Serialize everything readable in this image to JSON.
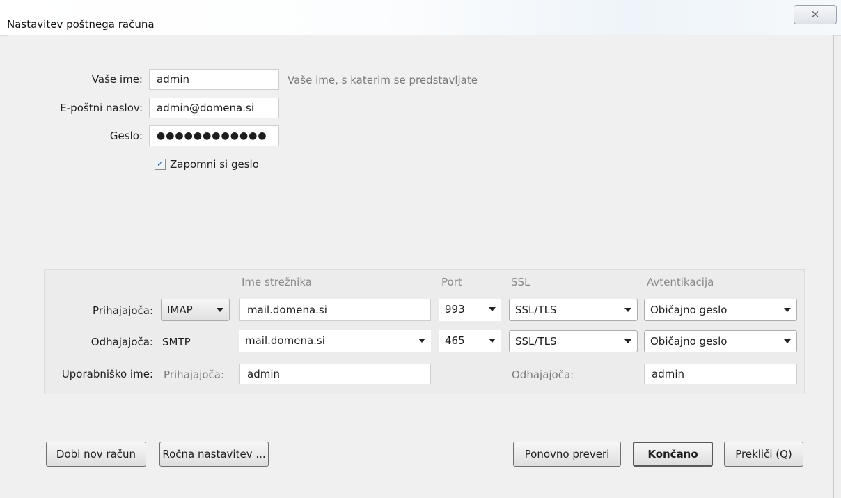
{
  "window": {
    "title": "Nastavitev poštnega računa",
    "close_glyph": "⨯"
  },
  "identity": {
    "name_label": "Vaše ime:",
    "name_value": "admin",
    "name_hint": "Vaše ime, s katerim se predstavljate",
    "email_label": "E-poštni naslov:",
    "email_value": "admin@domena.si",
    "password_label": "Geslo:",
    "password_value": "●●●●●●●●●●●●",
    "remember_label": "Zapomni si geslo",
    "remember_checked": true
  },
  "server": {
    "col_hostname": "Ime strežnika",
    "col_port": "Port",
    "col_ssl": "SSL",
    "col_auth": "Avtentikacija",
    "incoming": {
      "label": "Prihajajoča:",
      "protocol": "IMAP",
      "hostname": "mail.domena.si",
      "port": "993",
      "ssl": "SSL/TLS",
      "auth": "Običajno geslo"
    },
    "outgoing": {
      "label": "Odhajajoča:",
      "protocol": "SMTP",
      "hostname": "mail.domena.si",
      "port": "465",
      "ssl": "SSL/TLS",
      "auth": "Običajno geslo"
    },
    "username": {
      "label": "Uporabniško ime:",
      "incoming_label": "Prihajajoča:",
      "incoming_value": "admin",
      "outgoing_label": "Odhajajoča:",
      "outgoing_value": "admin"
    }
  },
  "buttons": {
    "new_account": "Dobi nov račun",
    "manual_config": "Ročna nastavitev ...",
    "retest": "Ponovno preveri",
    "done": "Končano",
    "cancel": "Prekliči (Q)"
  }
}
